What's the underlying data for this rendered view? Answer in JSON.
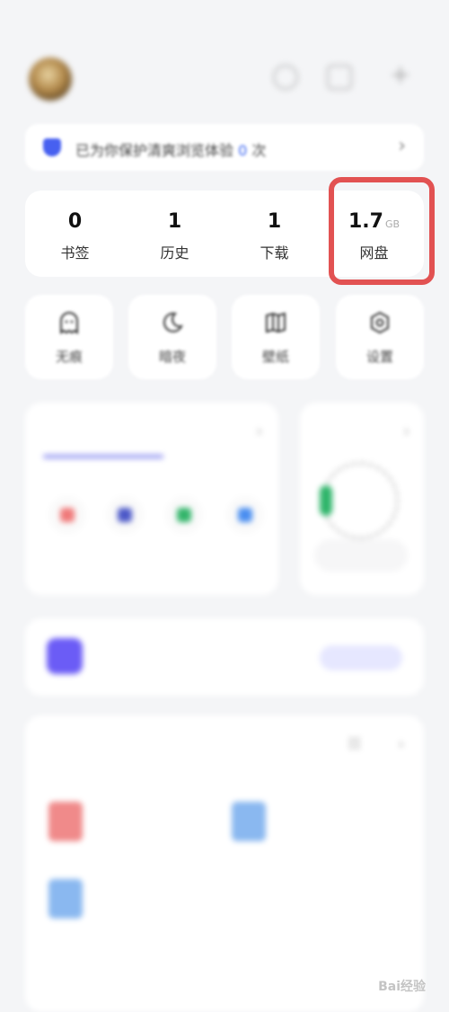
{
  "status_bar": {
    "time": "",
    "icons": ""
  },
  "profile": {
    "username": "",
    "icons": [
      "settings-icon",
      "edit-icon",
      "add-icon"
    ]
  },
  "protection": {
    "text_before": "已为你保护",
    "text_mid": "清爽浏览体验",
    "count": "0",
    "text_after": "次",
    "accent": "#3a64f0"
  },
  "stats": [
    {
      "value": "0",
      "unit": "",
      "label": "书签"
    },
    {
      "value": "1",
      "unit": "",
      "label": "历史"
    },
    {
      "value": "1",
      "unit": "",
      "label": "下载"
    },
    {
      "value": "1.7",
      "unit": "GB",
      "label": "网盘"
    }
  ],
  "highlight_color": "#e25252",
  "quick_tiles": [
    {
      "icon": "ghost-icon",
      "label": "无痕"
    },
    {
      "icon": "moon-icon",
      "label": "暗夜"
    },
    {
      "icon": "book-icon",
      "label": "壁纸"
    },
    {
      "icon": "gear-icon",
      "label": "设置"
    }
  ],
  "tools_card": {
    "title": "",
    "items": [
      {
        "name": ""
      },
      {
        "name": ""
      },
      {
        "name": ""
      },
      {
        "name": ""
      }
    ]
  },
  "space_card": {
    "title": "",
    "button": ""
  },
  "promo_card": {
    "title": "",
    "subtitle": "",
    "button": ""
  },
  "files_card": {
    "title": "",
    "date": "",
    "files": [
      {
        "name": ""
      },
      {
        "name": ""
      },
      {
        "name": ""
      }
    ],
    "more_date": ""
  },
  "watermark": "Bai经验"
}
